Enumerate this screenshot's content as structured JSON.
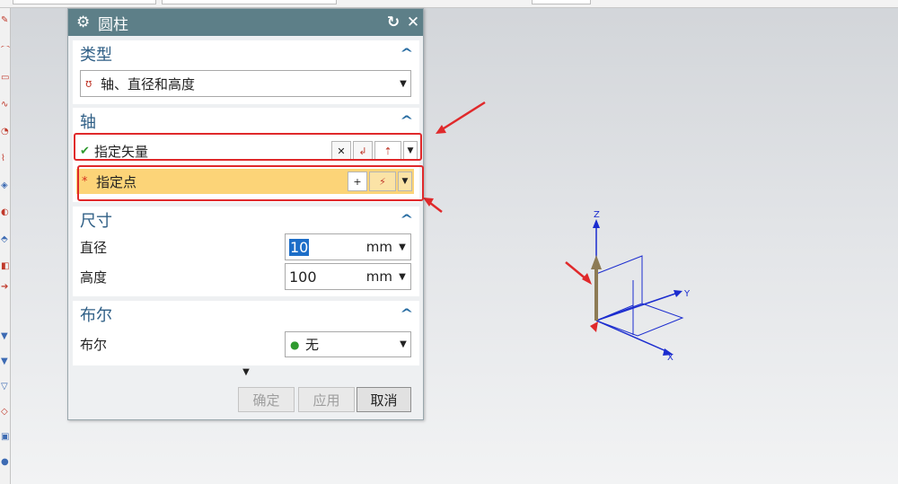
{
  "dialog": {
    "title": "圆柱",
    "title_icon": "gear-icon",
    "reset_icon": "reset-icon",
    "close_icon": "close-icon",
    "type_section": {
      "header": "类型",
      "selected": "轴、直径和高度",
      "icon": "cylinder-type-icon"
    },
    "axis_section": {
      "header": "轴",
      "vector_label": "指定矢量",
      "vector_status": "checkmark-icon",
      "point_label": "指定点",
      "point_status": "required-asterisk"
    },
    "dimension_section": {
      "header": "尺寸",
      "diameter_label": "直径",
      "diameter_value": "10",
      "diameter_unit": "mm",
      "height_label": "高度",
      "height_value": "100",
      "height_unit": "mm"
    },
    "boolean_section": {
      "header": "布尔",
      "label": "布尔",
      "selected": "无",
      "icon": "boolean-none-icon"
    },
    "buttons": {
      "ok": "确定",
      "apply": "应用",
      "cancel": "取消"
    }
  },
  "viewport": {
    "axis_z": "Z",
    "axis_y": "Y",
    "axis_x": "X"
  },
  "colors": {
    "title_bar": "#5d7f88",
    "section_header": "#2f5f86",
    "active_row": "#fcd478",
    "annotation_red": "#e0292b",
    "axis_blue": "#1b2ccf",
    "vector_arrow": "#8d7b55"
  }
}
